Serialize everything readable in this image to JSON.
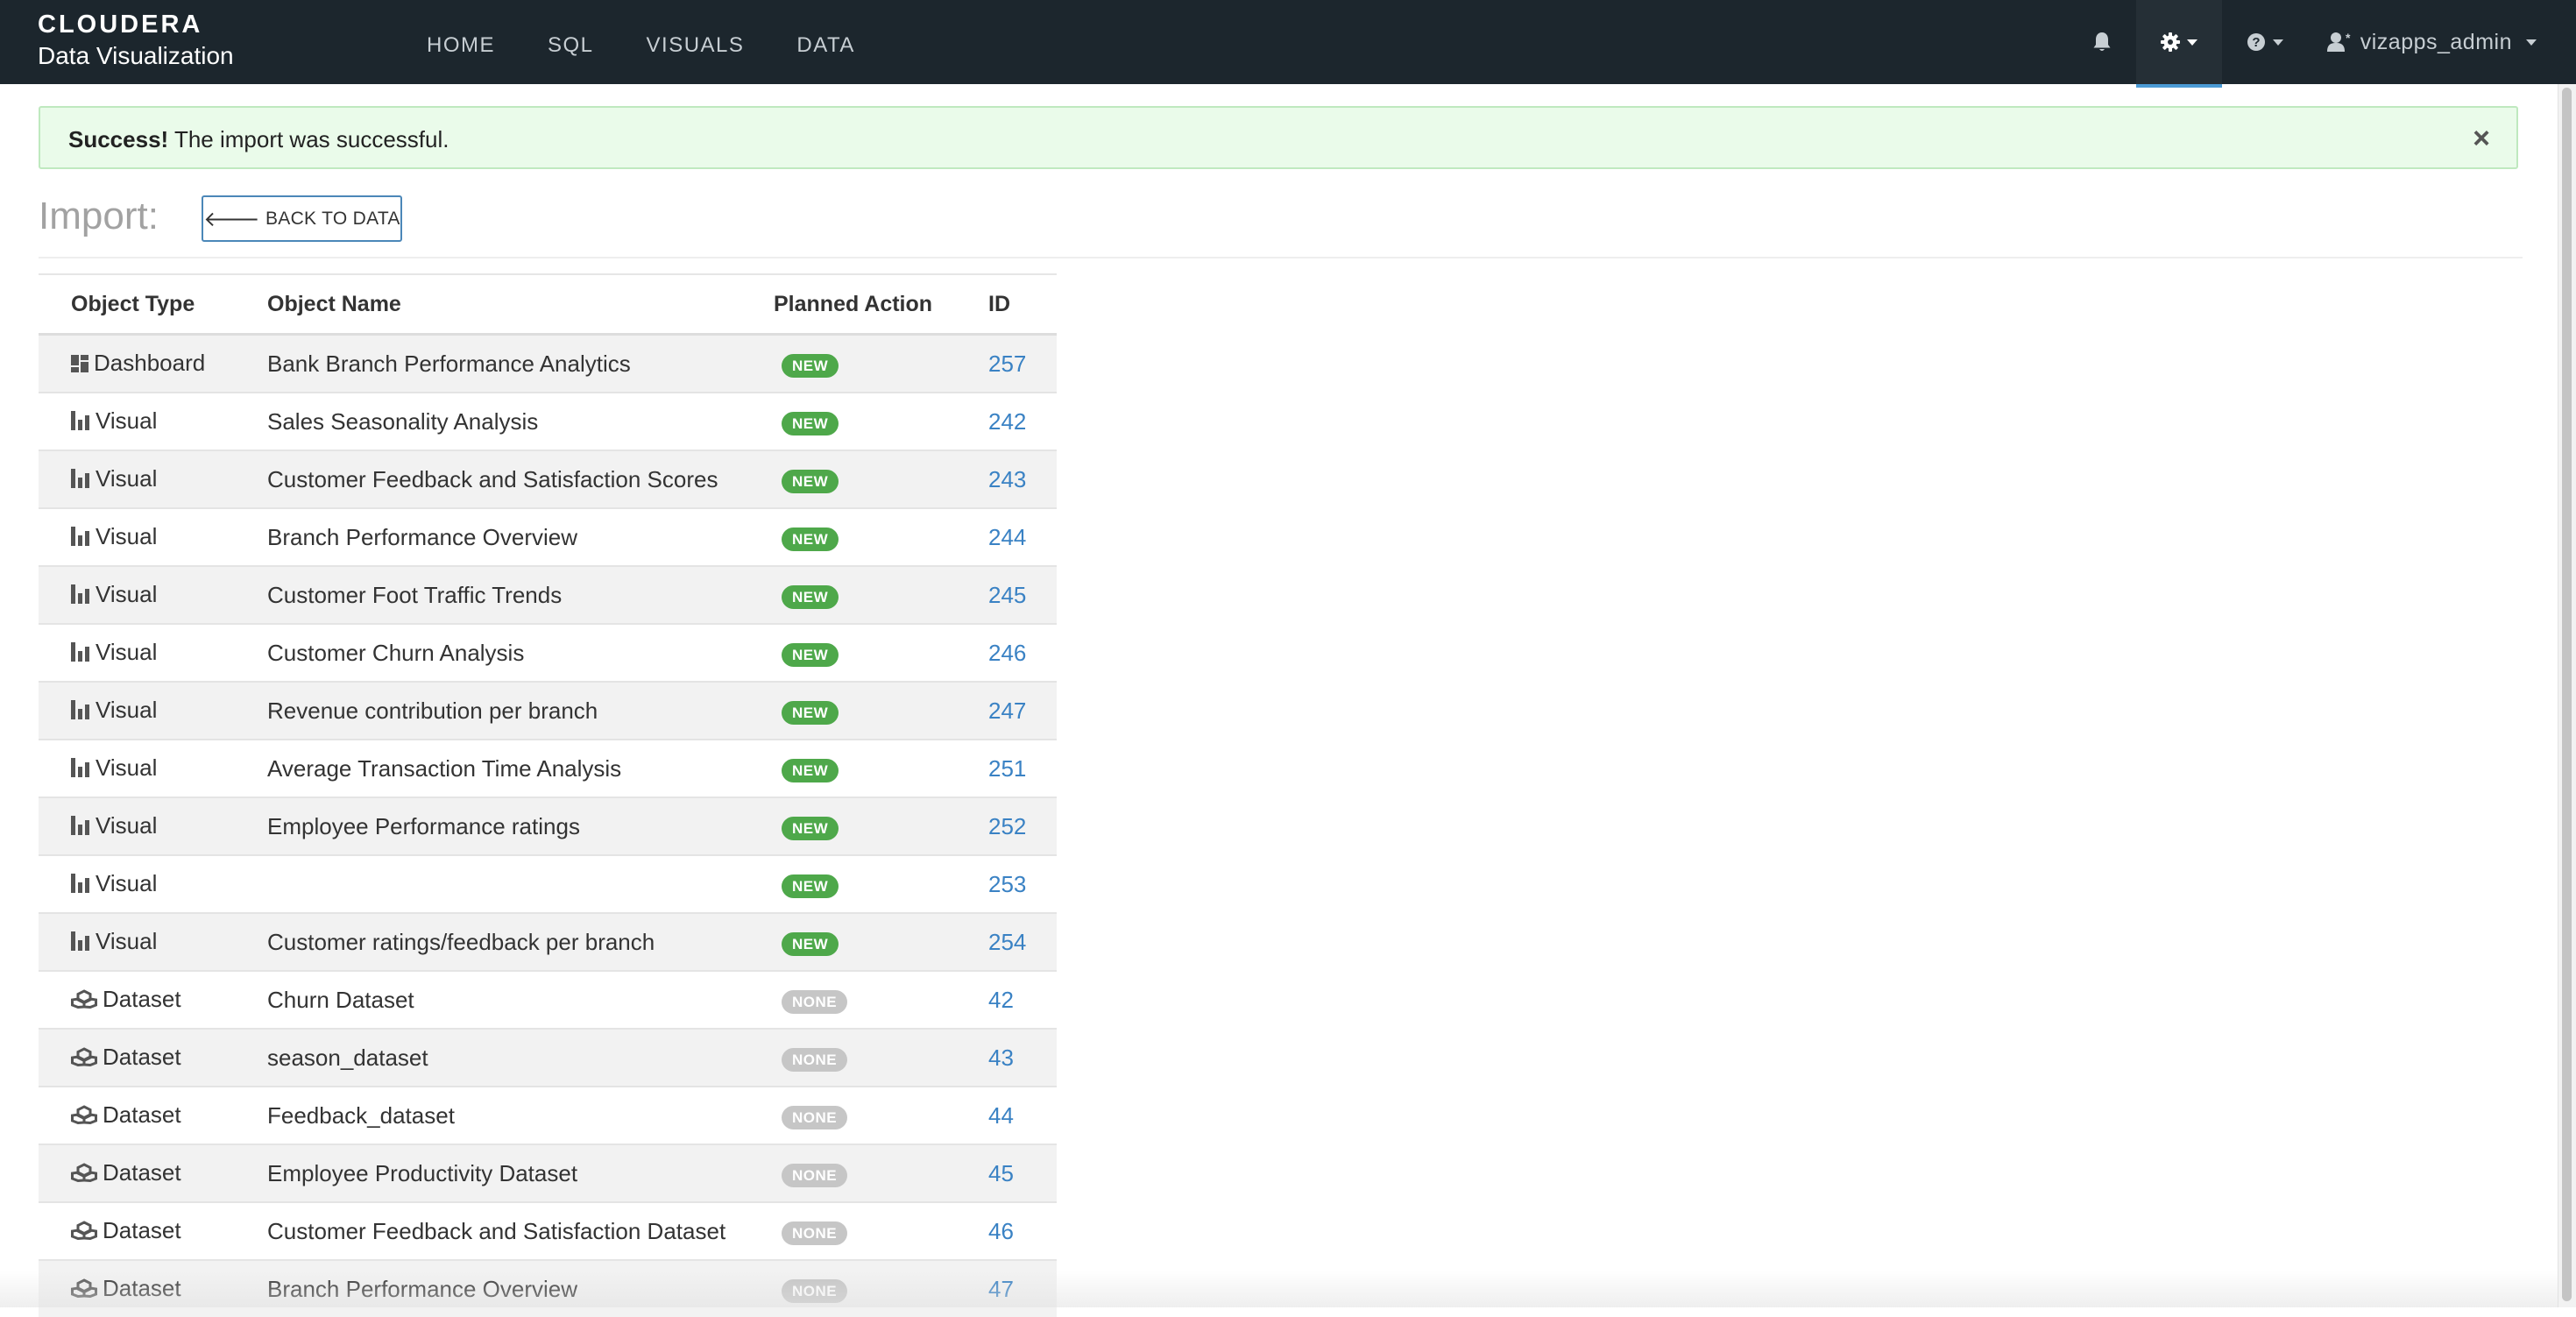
{
  "navbar": {
    "brand_logo": "CLOUDERA",
    "brand_subtitle": "Data Visualization",
    "links": [
      "HOME",
      "SQL",
      "VISUALS",
      "DATA"
    ],
    "user": "vizapps_admin"
  },
  "alert": {
    "strong": "Success!",
    "message": " The import was successful.",
    "close": "×"
  },
  "page": {
    "title": "Import:",
    "back_button": "BACK TO DATA"
  },
  "table": {
    "columns": [
      "Object Type",
      "Object Name",
      "Planned Action",
      "ID"
    ],
    "rows": [
      {
        "type": "Dashboard",
        "icon": "dashboard-icon",
        "name": "Bank Branch Performance Analytics",
        "action": "NEW",
        "id": "257"
      },
      {
        "type": "Visual",
        "icon": "bar-chart-icon",
        "name": "Sales Seasonality Analysis",
        "action": "NEW",
        "id": "242"
      },
      {
        "type": "Visual",
        "icon": "bar-chart-icon",
        "name": "Customer Feedback and Satisfaction Scores",
        "action": "NEW",
        "id": "243"
      },
      {
        "type": "Visual",
        "icon": "bar-chart-icon",
        "name": "Branch Performance Overview",
        "action": "NEW",
        "id": "244"
      },
      {
        "type": "Visual",
        "icon": "bar-chart-icon",
        "name": "Customer Foot Traffic Trends",
        "action": "NEW",
        "id": "245"
      },
      {
        "type": "Visual",
        "icon": "bar-chart-icon",
        "name": "Customer Churn Analysis",
        "action": "NEW",
        "id": "246"
      },
      {
        "type": "Visual",
        "icon": "bar-chart-icon",
        "name": "Revenue contribution per branch",
        "action": "NEW",
        "id": "247"
      },
      {
        "type": "Visual",
        "icon": "bar-chart-icon",
        "name": "Average Transaction Time Analysis",
        "action": "NEW",
        "id": "251"
      },
      {
        "type": "Visual",
        "icon": "bar-chart-icon",
        "name": "Employee Performance ratings",
        "action": "NEW",
        "id": "252"
      },
      {
        "type": "Visual",
        "icon": "bar-chart-icon",
        "name": "",
        "action": "NEW",
        "id": "253"
      },
      {
        "type": "Visual",
        "icon": "bar-chart-icon",
        "name": "Customer ratings/feedback per branch",
        "action": "NEW",
        "id": "254"
      },
      {
        "type": "Dataset",
        "icon": "dataset-icon",
        "name": "Churn Dataset",
        "action": "NONE",
        "id": "42"
      },
      {
        "type": "Dataset",
        "icon": "dataset-icon",
        "name": "season_dataset",
        "action": "NONE",
        "id": "43"
      },
      {
        "type": "Dataset",
        "icon": "dataset-icon",
        "name": "Feedback_dataset",
        "action": "NONE",
        "id": "44"
      },
      {
        "type": "Dataset",
        "icon": "dataset-icon",
        "name": "Employee Productivity Dataset",
        "action": "NONE",
        "id": "45"
      },
      {
        "type": "Dataset",
        "icon": "dataset-icon",
        "name": "Customer Feedback and Satisfaction Dataset",
        "action": "NONE",
        "id": "46"
      },
      {
        "type": "Dataset",
        "icon": "dataset-icon",
        "name": "Branch Performance Overview",
        "action": "NONE",
        "id": "47"
      }
    ]
  },
  "colors": {
    "navbar_bg": "#1c262d",
    "alert_bg": "#eafbea",
    "badge_new": "#4ea84a",
    "badge_none": "#c6c6c6",
    "link": "#3a82c4"
  }
}
